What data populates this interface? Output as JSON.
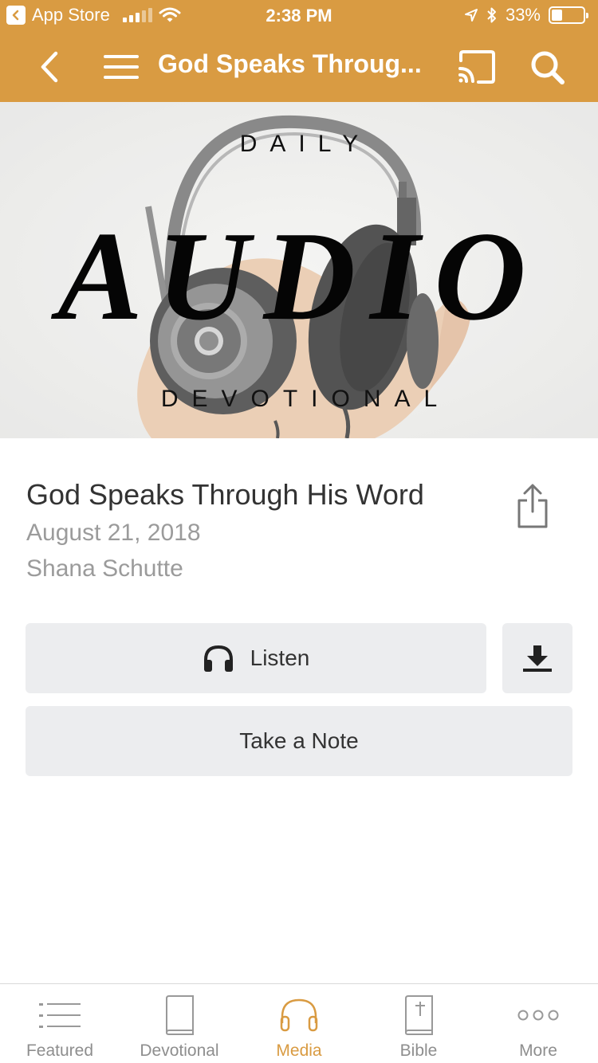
{
  "status_bar": {
    "back_app_label": "App Store",
    "time": "2:38 PM",
    "battery_text": "33%",
    "battery_level": 0.33
  },
  "nav": {
    "title": "God Speaks Throug..."
  },
  "hero": {
    "line1": "DAILY",
    "line2": "AUDIO",
    "line3": "DEVOTIONAL"
  },
  "item": {
    "title": "God Speaks Through His Word",
    "date": "August 21, 2018",
    "author": "Shana Schutte"
  },
  "actions": {
    "listen_label": "Listen",
    "note_label": "Take a Note"
  },
  "tabs": [
    {
      "label": "Featured",
      "icon": "list-icon",
      "active": false
    },
    {
      "label": "Devotional",
      "icon": "book-icon",
      "active": false
    },
    {
      "label": "Media",
      "icon": "headphones-icon",
      "active": true
    },
    {
      "label": "Bible",
      "icon": "bible-icon",
      "active": false
    },
    {
      "label": "More",
      "icon": "more-icon",
      "active": false
    }
  ],
  "colors": {
    "accent": "#d99b42",
    "button_bg": "#ecedef",
    "secondary_text": "#9b9b9b"
  }
}
